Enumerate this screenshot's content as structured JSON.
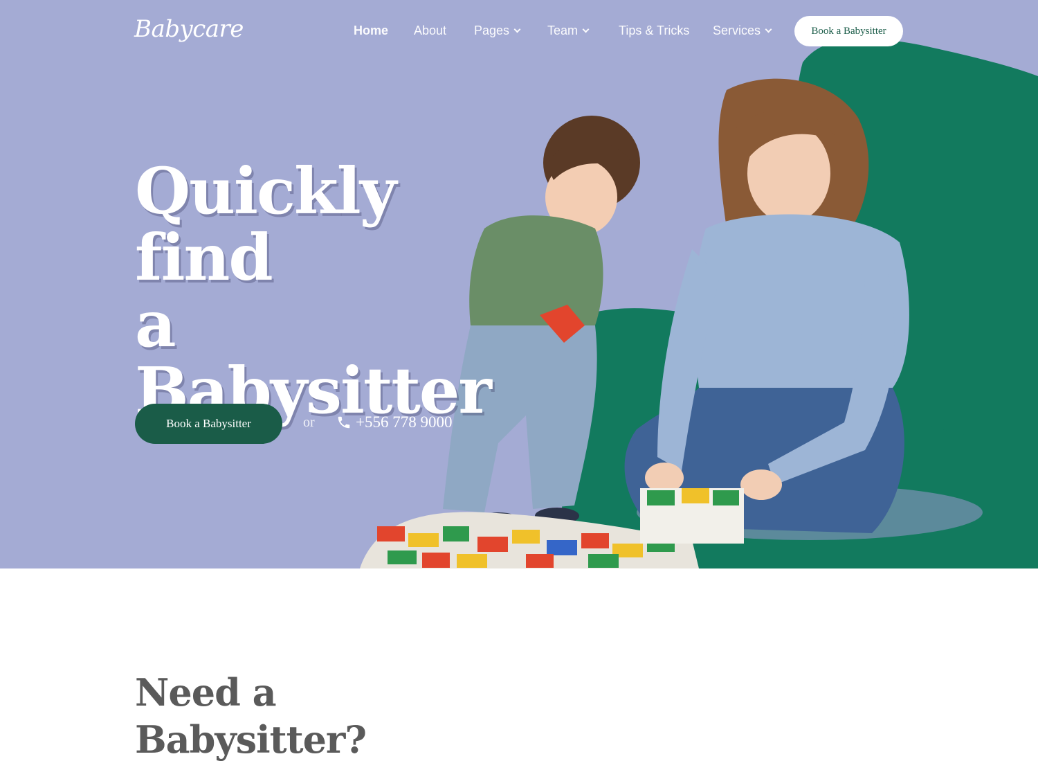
{
  "brand": {
    "logo": "Babycare"
  },
  "nav": {
    "items": [
      {
        "label": "Home",
        "has_dropdown": false
      },
      {
        "label": "About",
        "has_dropdown": false
      },
      {
        "label": "Pages",
        "has_dropdown": true
      },
      {
        "label": "Team",
        "has_dropdown": true
      },
      {
        "label": "Tips & Tricks",
        "has_dropdown": false
      },
      {
        "label": "Services",
        "has_dropdown": true
      }
    ],
    "cta_label": "Book a Babysitter"
  },
  "hero": {
    "title_lines": [
      "Quickly find",
      "a",
      "Babysitter"
    ],
    "cta_label": "Book a Babysitter",
    "or_text": "or",
    "phone": "+556 778 9000",
    "phone_icon": "phone-icon",
    "image": "mother-and-child-playing-with-building-blocks"
  },
  "section": {
    "title_lines": [
      "Need a",
      "Babysitter?"
    ]
  },
  "colors": {
    "hero_bg": "#a4abd4",
    "accent_green": "#1a5c48",
    "blob_green": "#127a5e",
    "heading_gray": "#5a5a5a"
  }
}
